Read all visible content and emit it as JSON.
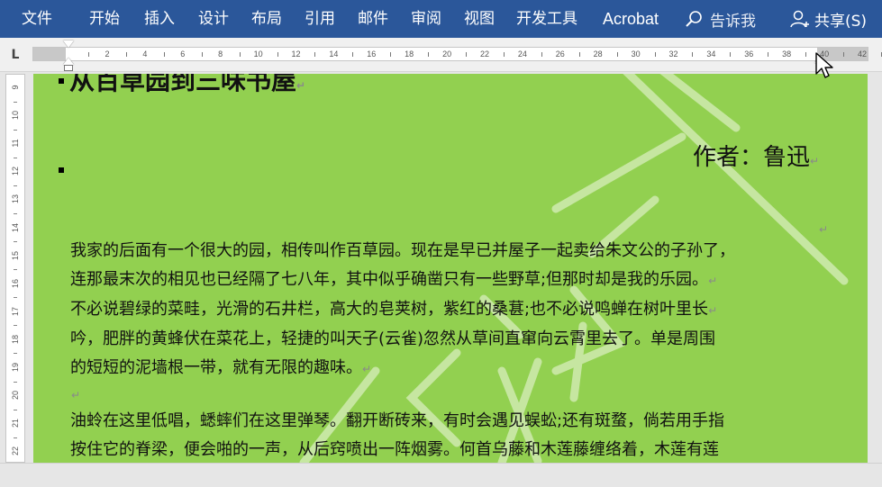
{
  "ribbon": {
    "tabs": [
      "文件",
      "开始",
      "插入",
      "设计",
      "布局",
      "引用",
      "邮件",
      "审阅",
      "视图",
      "开发工具",
      "Acrobat"
    ],
    "tell_me": "告诉我",
    "share": "共享(S)"
  },
  "ruler": {
    "tab_selector": "L",
    "labels": [
      "2",
      "4",
      "6",
      "8",
      "10",
      "12",
      "14",
      "16",
      "18",
      "20",
      "22",
      "24",
      "26",
      "28",
      "30",
      "32",
      "34",
      "36",
      "38",
      "40",
      "42"
    ],
    "vertical_labels": [
      "9",
      "10",
      "11",
      "12",
      "13",
      "14",
      "15",
      "16",
      "17",
      "18",
      "19",
      "20",
      "21",
      "22"
    ]
  },
  "document": {
    "title": "从百草园到三味书屋",
    "author": "作者：鲁迅",
    "paragraph_mark": "↵",
    "paragraph1_lines": [
      "我家的后面有一个很大的园，相传叫作百草园。现在是早已并屋子一起卖给朱文公的子孙了，",
      "连那最末次的相见也已经隔了七八年，其中似乎确凿只有一些野草;但那时却是我的乐园。",
      "不必说碧绿的菜畦，光滑的石井栏，高大的皂荚树，紫红的桑葚;也不必说鸣蝉在树叶里长",
      "吟，肥胖的黄蜂伏在菜花上，轻捷的叫天子(云雀)忽然从草间直窜向云霄里去了。单是周围",
      "的短短的泥墙根一带，就有无限的趣味。"
    ],
    "paragraph2_lines": [
      "油蛉在这里低唱，蟋蟀们在这里弹琴。翻开断砖来，有时会遇见蜈蚣;还有斑蝥，倘若用手指",
      "按住它的脊梁，便会啪的一声，从后窍喷出一阵烟雾。何首乌藤和木莲藤缠络着，木莲有莲"
    ]
  },
  "colors": {
    "ribbon": "#2b579a",
    "page_background": "#92d050",
    "watermark": "#c9e8a6"
  }
}
